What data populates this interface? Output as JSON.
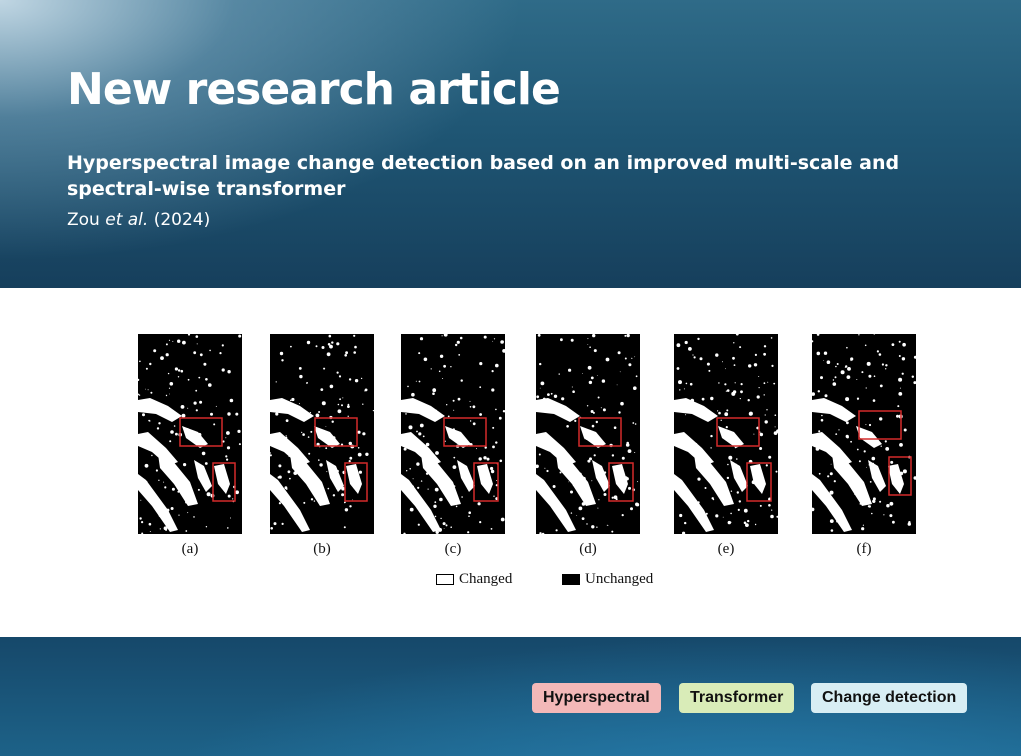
{
  "header": {
    "headline": "New research article",
    "article_title": "Hyperspectral image change detection based on an improved multi-scale and spectral-wise transformer",
    "citation_author": "Zou",
    "citation_etal": "et al.",
    "citation_year": "(2024)"
  },
  "figure": {
    "panels": [
      {
        "label": "(a)"
      },
      {
        "label": "(b)"
      },
      {
        "label": "(c)"
      },
      {
        "label": "(d)"
      },
      {
        "label": "(e)"
      },
      {
        "label": "(f)"
      }
    ],
    "legend": {
      "changed": "Changed",
      "unchanged": "Unchanged"
    }
  },
  "tags": [
    {
      "label": "Hyperspectral",
      "color": "#f3b8b8"
    },
    {
      "label": "Transformer",
      "color": "#d9ecb8"
    },
    {
      "label": "Change detection",
      "color": "#d8eef4"
    }
  ],
  "colors": {
    "highlight_box": "#d42a2a",
    "header_text": "#ffffff"
  }
}
